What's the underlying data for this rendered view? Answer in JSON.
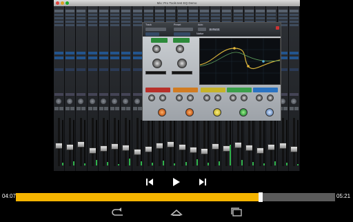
{
  "window": {
    "title": "Mix: Pro Tools test EQ Demo"
  },
  "plugin": {
    "header_labels": [
      "Track",
      "Preset",
      "Auto"
    ],
    "bypass_label": "BYPASS",
    "native_label": "Native"
  },
  "player": {
    "current_time": "04:07",
    "duration": "05:21",
    "progress": 0.767,
    "accent": "#f5b400"
  },
  "icons": {
    "prev": "skip-previous-icon",
    "play": "play-icon",
    "next": "skip-next-icon",
    "back": "back-icon",
    "home": "home-icon",
    "recents": "recent-apps-icon"
  }
}
